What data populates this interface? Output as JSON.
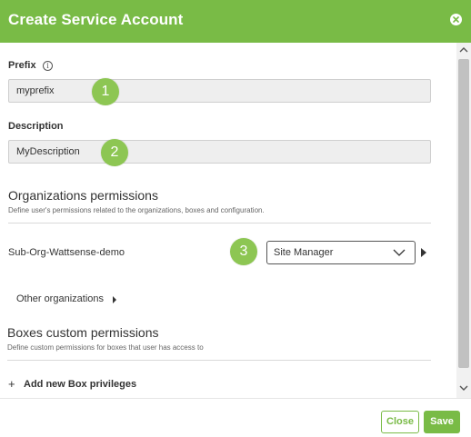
{
  "dialog": {
    "title": "Create Service Account",
    "close_icon": "close-circle-icon"
  },
  "prefix": {
    "label": "Prefix",
    "info_icon": "info-icon",
    "value": "myprefix",
    "badge": "1"
  },
  "description": {
    "label": "Description",
    "value": "MyDescription",
    "badge": "2"
  },
  "org_permissions": {
    "title": "Organizations permissions",
    "subtitle": "Define user's permissions related to the organizations, boxes and configuration.",
    "row": {
      "name": "Sub-Org-Wattsense-demo",
      "role": "Site Manager",
      "badge": "3"
    },
    "other_link": "Other organizations"
  },
  "box_permissions": {
    "title": "Boxes custom permissions",
    "subtitle": "Define custom permissions for boxes that user has access to",
    "add_symbol": "+",
    "add_label": "Add new Box privileges"
  },
  "footer": {
    "close_label": "Close",
    "save_label": "Save"
  },
  "colors": {
    "brand": "#79bb46",
    "badge": "#8dc653"
  }
}
